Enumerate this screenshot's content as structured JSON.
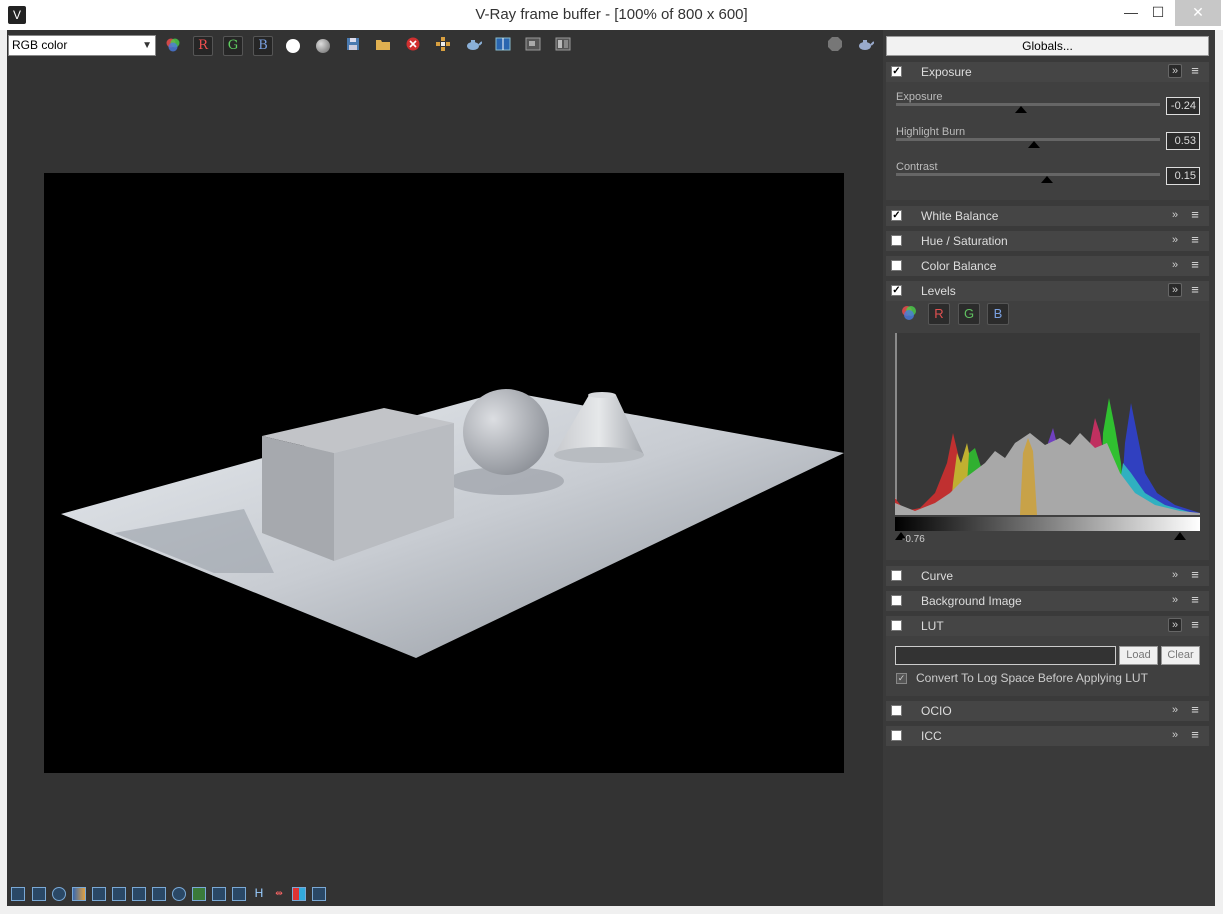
{
  "window": {
    "title": "V-Ray frame buffer - [100% of 800 x 600]",
    "minimize": "—",
    "maximize": "☐",
    "close": "✕"
  },
  "toolbar": {
    "channel_select": "RGB color",
    "channel_buttons": [
      "R",
      "G",
      "B"
    ],
    "icons": [
      "color-channels-icon",
      "white-ball-icon",
      "gray-ball-icon",
      "save-icon",
      "open-folder-icon",
      "clear-icon",
      "track-mouse-icon",
      "teapot-render-icon",
      "compare-icon",
      "region-render-icon",
      "history-icon",
      "stop-icon",
      "teapot-icon"
    ]
  },
  "globals_button": "Globals...",
  "sections": {
    "exposure": {
      "title": "Exposure",
      "checked": true,
      "sliders": [
        {
          "label": "Exposure",
          "value": "-0.24",
          "position": 0.48
        },
        {
          "label": "Highlight Burn",
          "value": "0.53",
          "position": 0.53
        },
        {
          "label": "Contrast",
          "value": "0.15",
          "position": 0.57
        }
      ]
    },
    "white_balance": {
      "title": "White Balance",
      "checked": true
    },
    "hue_saturation": {
      "title": "Hue / Saturation",
      "checked": false
    },
    "color_balance": {
      "title": "Color Balance",
      "checked": false
    },
    "levels": {
      "title": "Levels",
      "checked": true,
      "buttons": [
        "R",
        "G",
        "B"
      ],
      "black_point": "0.76",
      "black_point_prefix": "-"
    },
    "curve": {
      "title": "Curve",
      "checked": false
    },
    "background_image": {
      "title": "Background Image",
      "checked": false
    },
    "lut": {
      "title": "LUT",
      "checked": false,
      "load_label": "Load",
      "clear_label": "Clear",
      "log_space_label": "Convert To Log Space Before Applying LUT",
      "log_space_checked": true
    },
    "ocio": {
      "title": "OCIO",
      "checked": false
    },
    "icc": {
      "title": "ICC",
      "checked": false
    }
  },
  "colors": {
    "panel_bg": "#3a3a3a",
    "viewport_bg": "#333333",
    "render_bg": "#000000"
  }
}
